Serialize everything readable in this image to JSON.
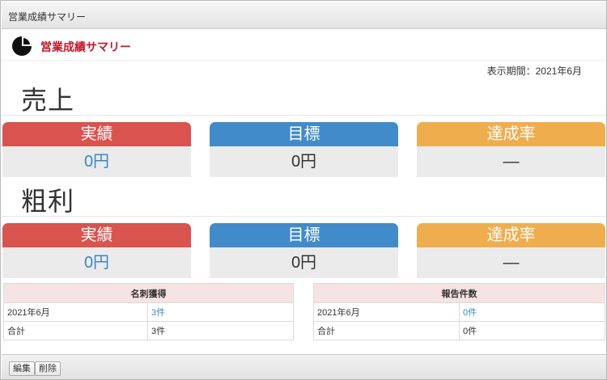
{
  "window": {
    "title": "営業成績サマリー"
  },
  "header": {
    "logo_icon": "pie-chart-icon",
    "title": "営業成績サマリー"
  },
  "period": "表示期間：2021年6月",
  "sales": {
    "title": "売上",
    "actual": {
      "label": "実績",
      "value": "0円"
    },
    "target": {
      "label": "目標",
      "value": "0円"
    },
    "rate": {
      "label": "達成率",
      "value": "—"
    }
  },
  "gross_profit": {
    "title": "粗利",
    "actual": {
      "label": "実績",
      "value": "0円"
    },
    "target": {
      "label": "目標",
      "value": "0円"
    },
    "rate": {
      "label": "達成率",
      "value": "—"
    }
  },
  "business_cards": {
    "header": "名刺獲得",
    "rows": [
      {
        "label": "2021年6月",
        "value": "3件"
      },
      {
        "label": "合計",
        "value": "3件"
      }
    ]
  },
  "reports": {
    "header": "報告件数",
    "rows": [
      {
        "label": "2021年6月",
        "value": "0件"
      },
      {
        "label": "合計",
        "value": "0件"
      }
    ]
  },
  "footer": {
    "edit_label": "編集",
    "delete_label": "削除"
  },
  "colors": {
    "actual": "#d9534f",
    "target": "#428bca",
    "rate": "#f0ad4e",
    "brand": "#c0182c",
    "link": "#3c86c9"
  }
}
